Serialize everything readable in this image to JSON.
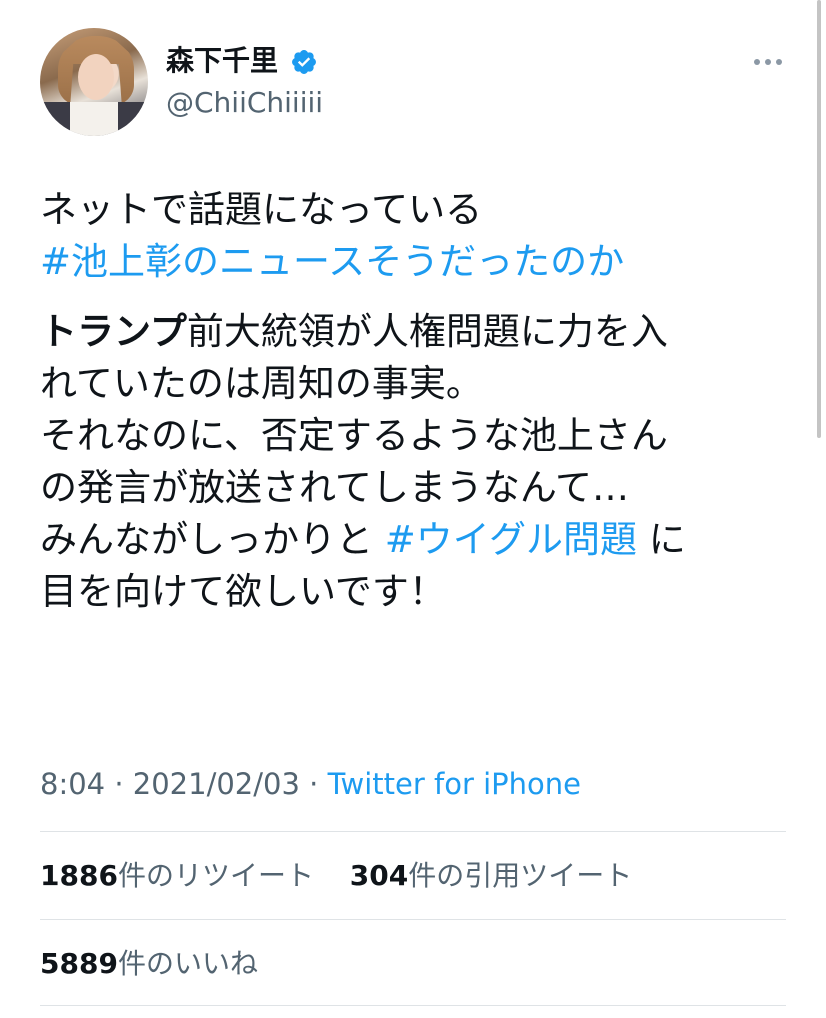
{
  "user": {
    "name": "森下千里",
    "handle": "@ChiiChiiiii",
    "verified_icon": "verified-badge-icon"
  },
  "tweet": {
    "line1": "ネットで話題になっている",
    "hashtag1": "#池上彰のニュースそうだったのか",
    "bold_word": "トランプ",
    "line3_rest": "前大統領が人権問題に力を入",
    "line4": "れていたのは周知の事実。",
    "line5": "それなのに、否定するような池上さん",
    "line6": "の発言が放送されてしまうなんて…",
    "line7_pre": "みんながしっかりと ",
    "hashtag2": "#ウイグル問題",
    "line7_post": " に",
    "line8": "目を向けて欲しいです！"
  },
  "meta": {
    "time": "8:04",
    "sep1": " · ",
    "date": "2021/02/03",
    "sep2": " · ",
    "source": "Twitter for iPhone"
  },
  "stats": {
    "retweets_count": "1886",
    "retweets_label": "件のリツイート",
    "quotes_count": "304",
    "quotes_label": "件の引用ツイート",
    "likes_count": "5889",
    "likes_label": "件のいいね"
  },
  "colors": {
    "link": "#1d9bf0",
    "secondary_text": "#536471",
    "primary_text": "#0f1419"
  }
}
